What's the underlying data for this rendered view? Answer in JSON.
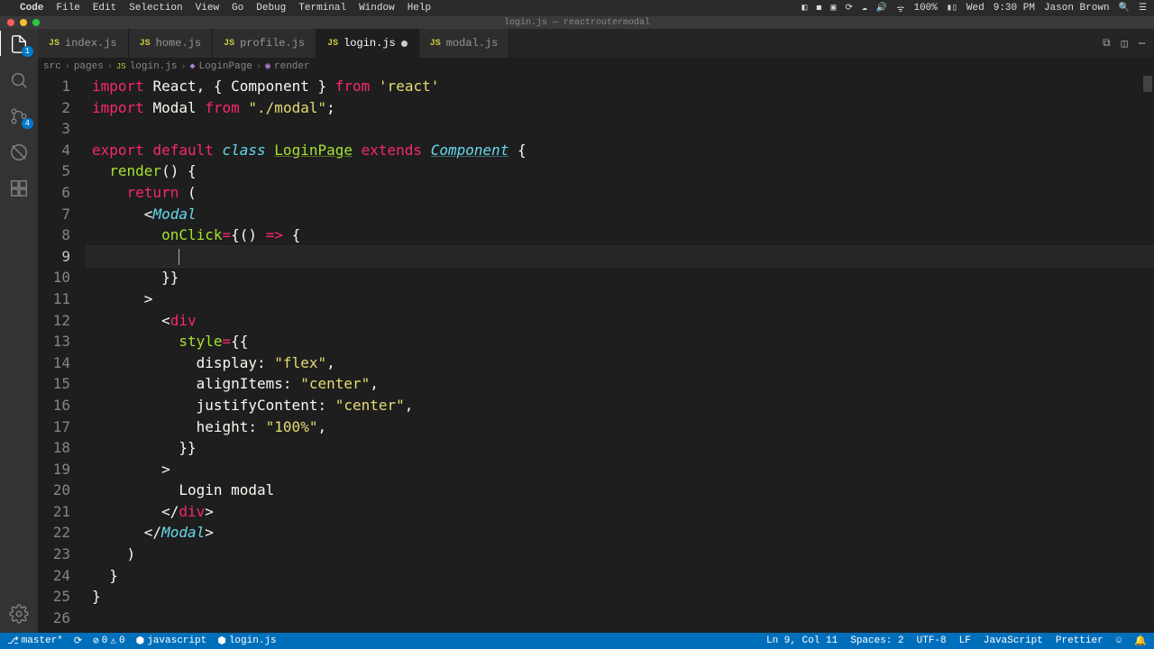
{
  "menubar": {
    "app": "Code",
    "items": [
      "File",
      "Edit",
      "Selection",
      "View",
      "Go",
      "Debug",
      "Terminal",
      "Window",
      "Help"
    ],
    "right": {
      "battery": "100%",
      "day": "Wed",
      "time": "9:30 PM",
      "user": "Jason Brown"
    }
  },
  "window": {
    "title": "login.js — reactroutermodal"
  },
  "tabs": [
    {
      "label": "index.js",
      "active": false,
      "modified": false
    },
    {
      "label": "home.js",
      "active": false,
      "modified": false
    },
    {
      "label": "profile.js",
      "active": false,
      "modified": false
    },
    {
      "label": "login.js",
      "active": true,
      "modified": true
    },
    {
      "label": "modal.js",
      "active": false,
      "modified": false
    }
  ],
  "breadcrumb": {
    "parts": [
      "src",
      "pages",
      "login.js",
      "LoginPage",
      "render"
    ]
  },
  "activitybar": {
    "explorer_badge": "1",
    "scm_badge": "4"
  },
  "statusbar": {
    "branch": "master*",
    "errors": "0",
    "warnings": "0",
    "lang_server": "javascript",
    "file": "login.js",
    "cursor": "Ln 9, Col 11",
    "spaces": "Spaces: 2",
    "encoding": "UTF-8",
    "eol": "LF",
    "language": "JavaScript",
    "formatter": "Prettier"
  },
  "code": {
    "line_count": 26,
    "active_line": 9,
    "tokens": [
      [
        [
          "import ",
          "tk-kw"
        ],
        [
          "React",
          "tk-pln"
        ],
        [
          ", { ",
          "tk-pln"
        ],
        [
          "Component",
          "tk-pln"
        ],
        [
          " } ",
          "tk-pln"
        ],
        [
          "from ",
          "tk-kw"
        ],
        [
          "'react'",
          "tk-str"
        ]
      ],
      [
        [
          "import ",
          "tk-kw"
        ],
        [
          "Modal ",
          "tk-pln"
        ],
        [
          "from ",
          "tk-kw"
        ],
        [
          "\"./modal\"",
          "tk-str"
        ],
        [
          ";",
          "tk-pln"
        ]
      ],
      [],
      [
        [
          "export ",
          "tk-kw"
        ],
        [
          "default ",
          "tk-kw"
        ],
        [
          "class ",
          "tk-kw2"
        ],
        [
          "LoginPage",
          "tk-comp2"
        ],
        [
          " extends ",
          "tk-kw"
        ],
        [
          "Component",
          "tk-comp"
        ],
        [
          " {",
          "tk-pln"
        ]
      ],
      [
        [
          "  ",
          "tk-pln"
        ],
        [
          "render",
          "tk-fn"
        ],
        [
          "() {",
          "tk-pln"
        ]
      ],
      [
        [
          "    ",
          "tk-pln"
        ],
        [
          "return ",
          "tk-kw"
        ],
        [
          "(",
          "tk-pln"
        ]
      ],
      [
        [
          "      <",
          "tk-pln"
        ],
        [
          "Modal",
          "tk-tagn"
        ]
      ],
      [
        [
          "        ",
          "tk-pln"
        ],
        [
          "onClick",
          "tk-attr"
        ],
        [
          "=",
          "tk-op"
        ],
        [
          "{() ",
          "tk-pln"
        ],
        [
          "=>",
          "tk-op"
        ],
        [
          " {",
          "tk-pln"
        ]
      ],
      [
        [
          "          ",
          "tk-pln"
        ]
      ],
      [
        [
          "        }}",
          "tk-pln"
        ]
      ],
      [
        [
          "      >",
          "tk-pln"
        ]
      ],
      [
        [
          "        <",
          "tk-pln"
        ],
        [
          "div",
          "tk-tag"
        ]
      ],
      [
        [
          "          ",
          "tk-pln"
        ],
        [
          "style",
          "tk-attr"
        ],
        [
          "=",
          "tk-op"
        ],
        [
          "{{",
          "tk-pln"
        ]
      ],
      [
        [
          "            display: ",
          "tk-pln"
        ],
        [
          "\"flex\"",
          "tk-str"
        ],
        [
          ",",
          "tk-pln"
        ]
      ],
      [
        [
          "            alignItems: ",
          "tk-pln"
        ],
        [
          "\"center\"",
          "tk-str"
        ],
        [
          ",",
          "tk-pln"
        ]
      ],
      [
        [
          "            justifyContent: ",
          "tk-pln"
        ],
        [
          "\"center\"",
          "tk-str"
        ],
        [
          ",",
          "tk-pln"
        ]
      ],
      [
        [
          "            height: ",
          "tk-pln"
        ],
        [
          "\"100%\"",
          "tk-str"
        ],
        [
          ",",
          "tk-pln"
        ]
      ],
      [
        [
          "          }}",
          "tk-pln"
        ]
      ],
      [
        [
          "        >",
          "tk-pln"
        ]
      ],
      [
        [
          "          Login modal",
          "tk-pln"
        ]
      ],
      [
        [
          "        </",
          "tk-pln"
        ],
        [
          "div",
          "tk-tag"
        ],
        [
          ">",
          "tk-pln"
        ]
      ],
      [
        [
          "      </",
          "tk-pln"
        ],
        [
          "Modal",
          "tk-tagn"
        ],
        [
          ">",
          "tk-pln"
        ]
      ],
      [
        [
          "    )",
          "tk-pln"
        ]
      ],
      [
        [
          "  }",
          "tk-pln"
        ]
      ],
      [
        [
          "}",
          "tk-pln"
        ]
      ],
      []
    ]
  }
}
